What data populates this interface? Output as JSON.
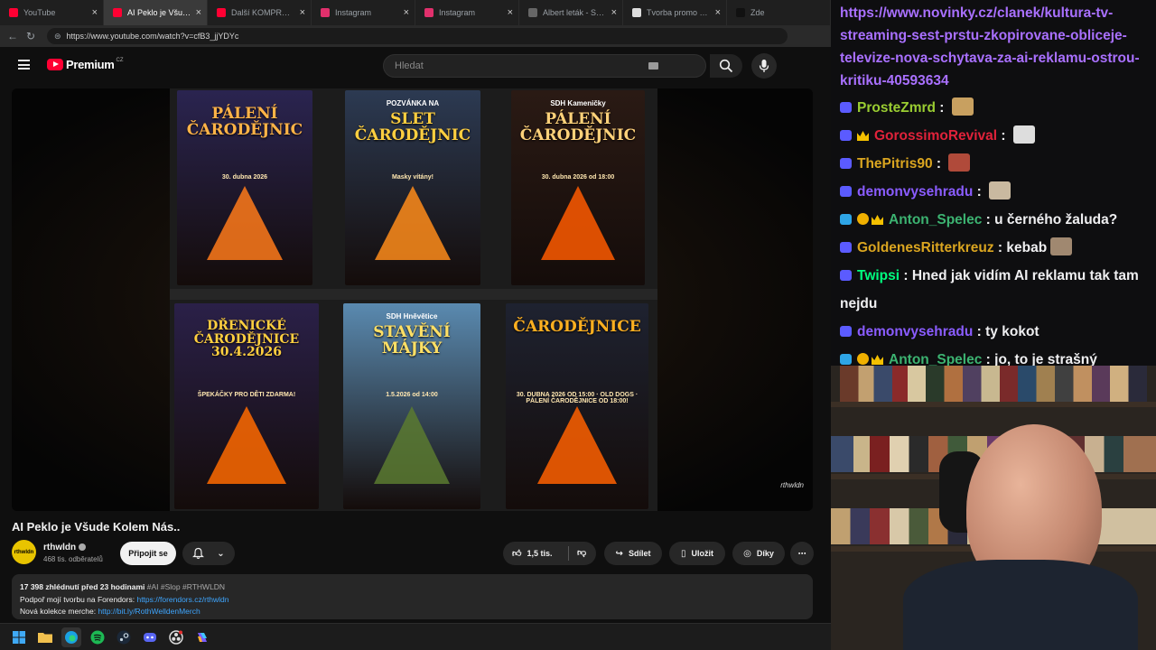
{
  "browser": {
    "tabs": [
      {
        "label": "YouTube",
        "color": "#ff0033",
        "active": false
      },
      {
        "label": "AI Peklo je Všude Kolem",
        "color": "#ff0033",
        "active": true
      },
      {
        "label": "Další KOMPROMITUJÍCÍ",
        "color": "#ff0033",
        "active": false
      },
      {
        "label": "Instagram",
        "color": "#e1306c",
        "active": false
      },
      {
        "label": "Instagram",
        "color": "#e1306c",
        "active": false
      },
      {
        "label": "Albert leták - Supermark",
        "color": "#666666",
        "active": false
      },
      {
        "label": "Tvorba promo obrázku",
        "color": "#dddddd",
        "active": false
      },
      {
        "label": "Zde",
        "color": "#111111",
        "active": false
      }
    ],
    "url": "https://www.youtube.com/watch?v=cfB3_jjYDYc"
  },
  "youtube": {
    "logo_text": "Premium",
    "logo_country": "CZ",
    "search_placeholder": "Hledat",
    "video_title": "AI Peklo je Všude Kolem Nás..",
    "channel": {
      "name": "rthwldn",
      "avatar_text": "rthwldn",
      "subscribers": "468 tis. odběratelů",
      "join_label": "Připojit se"
    },
    "actions": {
      "likes": "1,5 tis.",
      "share": "Sdílet",
      "save": "Uložit",
      "thanks": "Díky",
      "more": "⋯"
    },
    "description": {
      "stats": "17 398 zhlédnutí  před 23 hodinami",
      "tags": "#AI #Slop #RTHWLDN",
      "line1_text": "Podpoř mojí tvorbu na Forendors: ",
      "line1_link": "https://forendors.cz/rthwldn",
      "line2_text": "Nová kolekce merche: ",
      "line2_link": "http://bit.ly/RothWelldenMerch"
    },
    "watermark": "rthwldn",
    "posters": [
      {
        "title": "PÁLENÍ\nČARODĚJNIC",
        "sub": "30. dubna 2026",
        "bg": "#2a2450",
        "title_color": "#ffb347",
        "fire": "#ff7a1a"
      },
      {
        "title": "SLET\nČARODĚJNIC",
        "top": "POZVÁNKA NA",
        "sub": "Masky vítány!",
        "bg": "#2c3a52",
        "title_color": "#ffcf40",
        "fire": "#ff8c1a"
      },
      {
        "title": "PÁLENÍ\nČARODĚJNIC",
        "top": "SDH Kameničky",
        "sub": "30. dubna 2026 od 18:00",
        "bg": "#2a1a14",
        "title_color": "#ffd27a",
        "fire": "#ff5a00"
      },
      {
        "title": "DŘENICKÉ\nČARODĚJNICE\n30.4.2026",
        "sub": "ŠPEKÁČKY PRO DĚTI ZDARMA!",
        "bg": "#2a2048",
        "title_color": "#ffcf40",
        "fire": "#ff6a00"
      },
      {
        "title": "STAVĚNÍ MÁJKY",
        "top": "SDH Hněvětice",
        "sub": "1.5.2026 od 14:00",
        "bg": "#5a8ab0",
        "title_color": "#ffe066",
        "fire": "#5a7a30"
      },
      {
        "title": "ČARODĚJNICE",
        "sub": "30. DUBNA 2026 OD 15:00 · OLD DOGS · PÁLENÍ ČARODĚJNICE OD 18:00!",
        "bg": "#1e2230",
        "title_color": "#ffb020",
        "fire": "#ff6000"
      }
    ]
  },
  "taskbar": {
    "icons": [
      "windows-start-icon",
      "file-explorer-icon",
      "edge-browser-icon",
      "spotify-icon",
      "steam-icon",
      "discord-icon",
      "obs-icon",
      "copilot-icon"
    ]
  },
  "chat": {
    "link": "https://www.novinky.cz/clanek/kultura-tv-streaming-sest-prstu-zkopirovane-obliceje-televize-nova-schytava-za-ai-reklamu-ostrou-kritiku-40593634",
    "messages": [
      {
        "user": "ProsteZmrd",
        "color": "#9acd32",
        "text": "",
        "emote": "#c8a060",
        "badges": [
          "sub"
        ]
      },
      {
        "user": "GorossimoRevival",
        "color": "#e0223a",
        "text": "",
        "emote": "#dddddd",
        "badges": [
          "sub",
          "crown"
        ]
      },
      {
        "user": "ThePitris90",
        "color": "#daa520",
        "text": "",
        "emote": "#b04a3a",
        "badges": [
          "sub"
        ]
      },
      {
        "user": "demonvysehradu",
        "color": "#8a5cff",
        "text": "",
        "emote": "#c9b9a0",
        "badges": [
          "sub"
        ]
      },
      {
        "user": "Anton_Spelec",
        "color": "#3cb371",
        "text": "u černého žaluda?",
        "emote": "",
        "badges": [
          "sub2",
          "gold",
          "crown"
        ]
      },
      {
        "user": "GoldenesRitterkreuz",
        "color": "#daa520",
        "text": "kebab",
        "emote": "#a08870",
        "badges": [
          "sub"
        ]
      },
      {
        "user": "Twipsi",
        "color": "#00ff7f",
        "text": "Hned jak vidím AI reklamu tak tam nejdu",
        "emote": "",
        "badges": [
          "sub"
        ]
      },
      {
        "user": "demonvysehradu",
        "color": "#8a5cff",
        "text": "ty kokot",
        "emote": "",
        "badges": [
          "sub"
        ]
      },
      {
        "user": "Anton_Spelec",
        "color": "#3cb371",
        "text": "jo, to je strašný",
        "emote": "",
        "badges": [
          "sub2",
          "gold",
          "crown"
        ]
      }
    ]
  }
}
